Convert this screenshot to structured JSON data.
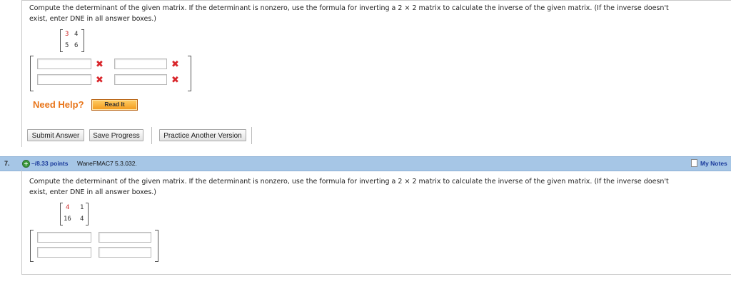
{
  "question6": {
    "text_line1": "Compute the determinant of the given matrix. If the determinant is nonzero, use the formula for inverting a 2 × 2 matrix to calculate the inverse of the given matrix. (If the inverse doesn't",
    "text_line2": "exist, enter DNE in all answer boxes.)",
    "matrix": {
      "a11": "3",
      "a12": "4",
      "a21": "5",
      "a22": "6"
    },
    "answers": [
      "",
      "",
      "",
      ""
    ],
    "answer_status": [
      "incorrect",
      "incorrect",
      "incorrect",
      "incorrect"
    ],
    "incorrect_mark": "✖",
    "need_help_label": "Need Help?",
    "read_it_label": "Read It",
    "buttons": {
      "submit": "Submit Answer",
      "save": "Save Progress",
      "practice": "Practice Another Version"
    }
  },
  "question7": {
    "number": "7.",
    "points": "–/8.33 points",
    "problem_id": "WaneFMAC7 5.3.032.",
    "my_notes": "My Notes",
    "expand_icon": "plus-circle-icon",
    "text_line1": "Compute the determinant of the given matrix. If the determinant is nonzero, use the formula for inverting a 2 × 2 matrix to calculate the inverse of the given matrix. (If the inverse doesn't",
    "text_line2": "exist, enter DNE in all answer boxes.)",
    "matrix": {
      "a11": "4",
      "a12": "1",
      "a21": "16",
      "a22": "4"
    },
    "answers": [
      "",
      "",
      "",
      ""
    ]
  },
  "colors": {
    "header_bar": "#a6c6e6",
    "points_text": "#1a3a9b",
    "need_help": "#e8751a",
    "incorrect": "#d9262b",
    "read_it_button": "#f39a1c"
  }
}
